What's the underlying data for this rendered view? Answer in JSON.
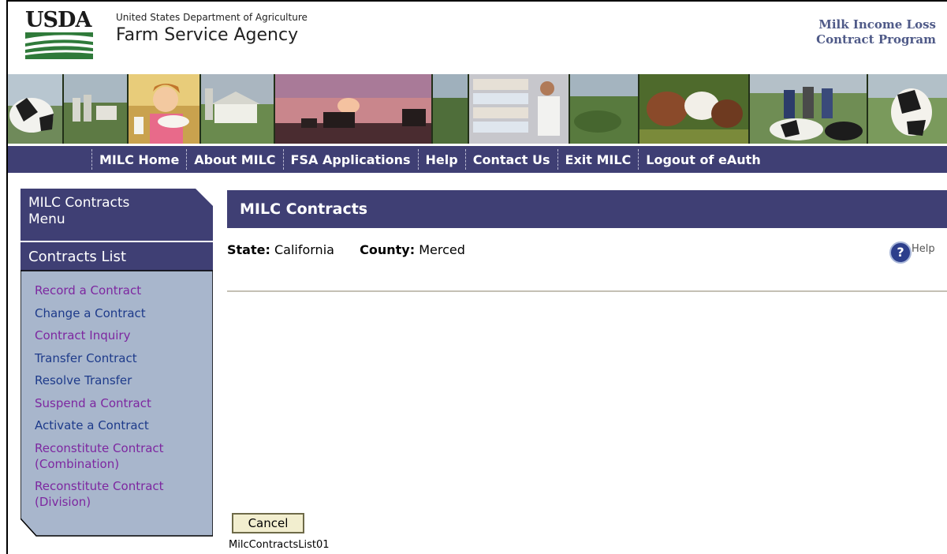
{
  "header": {
    "logo_text": "USDA",
    "department": "United States Department of Agriculture",
    "agency": "Farm Service Agency",
    "program_line1": "Milk Income Loss",
    "program_line2": "Contract Program"
  },
  "nav": {
    "items": [
      "MILC Home",
      "About MILC",
      "FSA Applications",
      "Help",
      "Contact Us",
      "Exit MILC",
      "Logout of eAuth"
    ]
  },
  "sidebar": {
    "menu_title": "MILC Contracts Menu",
    "list_heading": "Contracts List",
    "links": [
      "Record a Contract",
      "Change a Contract",
      "Contract Inquiry",
      "Transfer Contract",
      "Resolve Transfer",
      "Suspend a Contract",
      "Activate a Contract",
      "Reconstitute Contract (Combination)",
      "Reconstitute Contract (Division)"
    ]
  },
  "main": {
    "title": "MILC Contracts",
    "state_label": "State:",
    "state_value": "California",
    "county_label": "County:",
    "county_value": "Merced",
    "help_icon_glyph": "?",
    "help_label": "Help",
    "cancel_label": "Cancel",
    "screen_id": "MilcContractsList01"
  },
  "colors": {
    "nav_bg": "#3f3f74",
    "sidebar_bg": "#a8b6cc",
    "link_visited": "#7d27a0",
    "link": "#1d3a8a",
    "program_text": "#4f5a88",
    "button_bg": "#f2eecf"
  },
  "icons": {
    "help": "question-circle-icon",
    "logo": "usda-logo"
  }
}
